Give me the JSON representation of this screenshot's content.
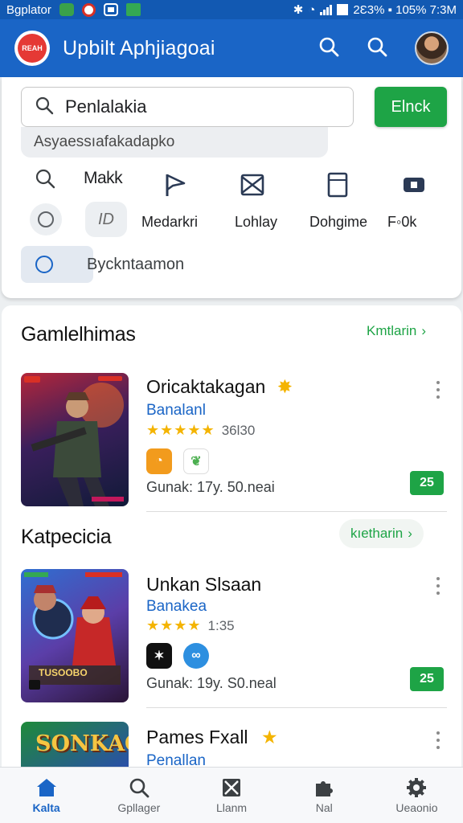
{
  "status_bar": {
    "left_text": "Bgplator",
    "right_text": "2Ɛ3% ▪ 105% 7:3M"
  },
  "app_bar": {
    "logo_text": "REAH",
    "title": "Upbilt Aphjiagoai"
  },
  "search": {
    "value": "Penlalakia",
    "button_label": "Elnck",
    "suggestion": "Asyaessıafakadapko"
  },
  "quick_row": {
    "label": "Makk"
  },
  "categories": [
    {
      "label": "Medarkri"
    },
    {
      "label": "Lohlay"
    },
    {
      "label": "Dohgime"
    },
    {
      "label": "F◦0k"
    }
  ],
  "id_pill": "ID",
  "bottom_option": "Byckntaamon",
  "sections": [
    {
      "title": "Gamlelhimas",
      "more": "Kmtlarin",
      "more_arrow": "›"
    },
    {
      "title": "Katpecicia",
      "more": "kıetharin",
      "more_arrow": "›"
    }
  ],
  "items": [
    {
      "title": "Oricaktakagan",
      "subtitle": "Banalanl",
      "stars": "★★★★★",
      "rating": "36l30",
      "meta": "Gunak: 17y. 50.neai",
      "badge": "25"
    },
    {
      "title": "Unkan Slsaan",
      "subtitle": "Banakea",
      "stars": "★★★★",
      "rating": "1:35",
      "meta": "Gunak: 19y. S0.neal",
      "badge": "25"
    },
    {
      "title": "Pames Fxall",
      "subtitle": "Penallan"
    }
  ],
  "thumb3_text": "SONKAC",
  "thumb2_text": "TUSOOBO",
  "bottom_nav": [
    {
      "label": "Kalta",
      "icon": "home-icon"
    },
    {
      "label": "Gpllager",
      "icon": "search-icon"
    },
    {
      "label": "Llanm",
      "icon": "box-icon"
    },
    {
      "label": "Nal",
      "icon": "puzzle-icon"
    },
    {
      "label": "Ueaonio",
      "icon": "gear-icon"
    }
  ],
  "colors": {
    "primary": "#1a65c6",
    "status": "#1259b2",
    "accent_green": "#1ea446",
    "star": "#f4b400"
  }
}
